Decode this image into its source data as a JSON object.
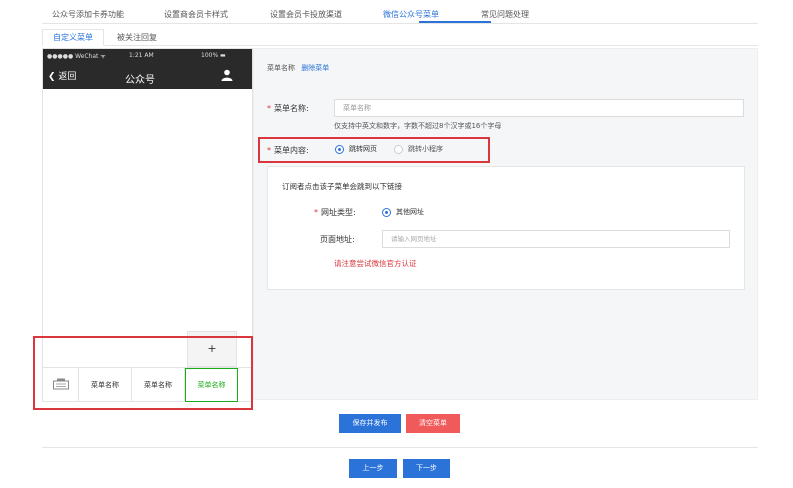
{
  "top_tabs": [
    {
      "label": "公众号添加卡券功能"
    },
    {
      "label": "设置商会员卡样式"
    },
    {
      "label": "设置会员卡投放渠道"
    },
    {
      "label": "微信公众号菜单"
    },
    {
      "label": "常见问题处理"
    }
  ],
  "sub_tabs": [
    {
      "label": "自定义菜单"
    },
    {
      "label": "被关注回复"
    }
  ],
  "phone": {
    "carrier": "●●●●● WeChat ᯤ",
    "time": "1:21 AM",
    "battery": "100% ▬",
    "back_label": "返回",
    "title": "公众号",
    "add_symbol": "+",
    "menu_items": [
      {
        "label": "菜单名称"
      },
      {
        "label": "菜单名称"
      },
      {
        "label": "菜单名称"
      }
    ]
  },
  "panel": {
    "header_label": "菜单名称",
    "delete_link": "删除菜单",
    "name_label": "菜单名称:",
    "name_value": "菜单名称",
    "name_hint": "仅支持中英文和数字，字数不超过8个汉字或16个字母",
    "content_label": "菜单内容:",
    "content_options": [
      {
        "label": "跳转网页",
        "selected": true
      },
      {
        "label": "跳转小程序",
        "selected": false
      }
    ],
    "link_box_title": "订阅者点击该子菜单会跳到以下链接",
    "url_type_label": "网址类型:",
    "url_type_option": "其他网址",
    "page_url_label": "页面地址:",
    "page_url_placeholder": "请输入网页地址",
    "warning": "请注意尝试微信官方认证"
  },
  "buttons": {
    "save_publish": "保存并发布",
    "clear_menu": "清空菜单",
    "prev": "上一步",
    "next": "下一步"
  },
  "colors": {
    "accent": "#2b73d8",
    "danger": "#d9363e",
    "active_menu": "#1aad19"
  }
}
